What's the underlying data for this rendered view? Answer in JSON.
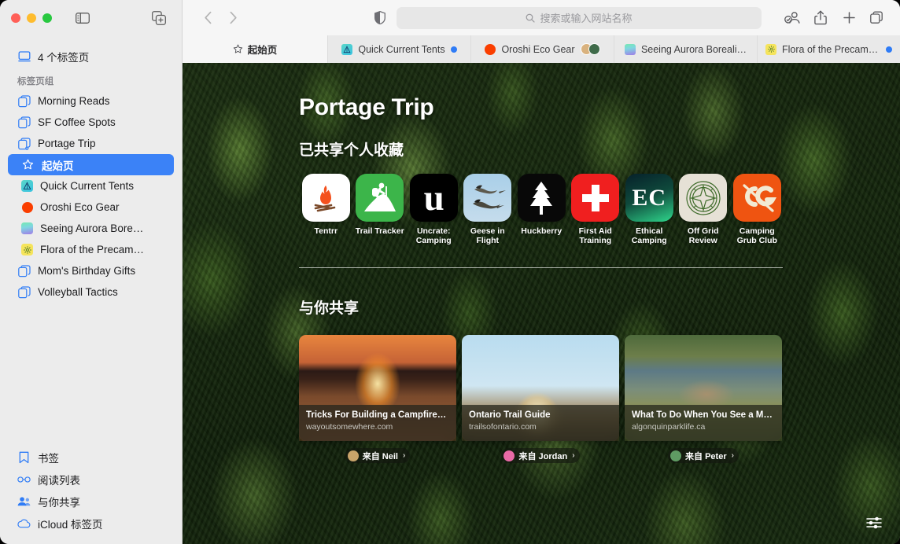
{
  "window": {
    "traffic_lights": [
      "close",
      "minimize",
      "zoom"
    ],
    "sidebar_toggle_icon": "sidebar-toggle-icon",
    "new_tab_group_icon": "new-tab-group-icon"
  },
  "sidebar": {
    "tab_count_label": "4 个标签页",
    "tab_count_icon": "window-icon",
    "group_header": "标签页组",
    "groups": [
      {
        "label": "Morning Reads",
        "icon": "tab-group-icon"
      },
      {
        "label": "SF Coffee Spots",
        "icon": "tab-group-icon"
      },
      {
        "label": "Portage Trip",
        "icon": "shared-tab-group-icon"
      }
    ],
    "tabs": [
      {
        "label": "起始页",
        "icon": "star-icon",
        "selected": true
      },
      {
        "label": "Quick Current Tents",
        "favicon": "tent-favicon",
        "selected": false
      },
      {
        "label": "Oroshi Eco Gear",
        "favicon": "orange-circle-favicon",
        "selected": false
      },
      {
        "label": "Seeing Aurora Bore…",
        "favicon": "aurora-gradient-favicon",
        "selected": false
      },
      {
        "label": "Flora of the Precam…",
        "favicon": "yellow-flora-favicon",
        "selected": false
      }
    ],
    "groups_after": [
      {
        "label": "Mom's Birthday Gifts",
        "icon": "tab-group-icon"
      },
      {
        "label": "Volleyball Tactics",
        "icon": "tab-group-icon"
      }
    ],
    "footer": [
      {
        "label": "书签",
        "icon": "bookmark-icon"
      },
      {
        "label": "阅读列表",
        "icon": "reading-list-icon"
      },
      {
        "label": "与你共享",
        "icon": "shared-with-you-icon"
      },
      {
        "label": "iCloud 标签页",
        "icon": "icloud-icon"
      }
    ]
  },
  "toolbar": {
    "back_icon": "chevron-left-icon",
    "forward_icon": "chevron-right-icon",
    "shield_icon": "privacy-shield-icon",
    "address_placeholder": "搜索或输入网站名称",
    "search_icon": "search-icon",
    "share_participants_icon": "shared-participants-icon",
    "share_icon": "share-icon",
    "new_tab_icon": "plus-icon",
    "tab_overview_icon": "tab-overview-icon"
  },
  "tabbar": {
    "tabs": [
      {
        "label": "起始页",
        "icon": "star-icon",
        "active": true,
        "dot": false,
        "avatars": []
      },
      {
        "label": "Quick Current Tents",
        "favicon": "tent-favicon",
        "active": false,
        "dot": true,
        "avatars": []
      },
      {
        "label": "Oroshi Eco Gear",
        "favicon": "orange-circle-favicon",
        "active": false,
        "dot": false,
        "avatars": [
          "avatar-a",
          "avatar-b"
        ]
      },
      {
        "label": "Seeing Aurora Boreali…",
        "favicon": "aurora-gradient-favicon",
        "active": false,
        "dot": false,
        "avatars": []
      },
      {
        "label": "Flora of the Precambi…",
        "favicon": "yellow-flora-favicon",
        "active": false,
        "dot": true,
        "avatars": []
      }
    ]
  },
  "start_page": {
    "title": "Portage Trip",
    "favorites_heading": "已共享个人收藏",
    "favorites": [
      {
        "name": "Tentrr",
        "icon": "campfire-favicon",
        "bg": "#ffffff"
      },
      {
        "name": "Trail Tracker",
        "icon": "hiker-favicon",
        "bg": "#3cb54a"
      },
      {
        "name": "Uncrate: Camping",
        "icon": "uncrate-u-favicon",
        "bg": "#000000"
      },
      {
        "name": "Geese in Flight",
        "icon": "geese-favicon",
        "bg": "#a8cce4"
      },
      {
        "name": "Huckberry",
        "icon": "pine-tree-favicon",
        "bg": "#0a0a0a"
      },
      {
        "name": "First Aid Training",
        "icon": "red-cross-favicon",
        "bg": "#f01f1f"
      },
      {
        "name": "Ethical Camping",
        "icon": "ec-monogram-favicon",
        "bg": "#0f3b32"
      },
      {
        "name": "Off Grid Review",
        "icon": "compass-favicon",
        "bg": "#e6e1d6"
      },
      {
        "name": "Camping Grub Club",
        "icon": "cg-skewer-favicon",
        "bg": "#ef5411"
      }
    ],
    "shared_heading": "与你共享",
    "shared_cards": [
      {
        "title": "Tricks For Building a Campfire—F…",
        "url": "wayoutsomewhere.com",
        "image": "campfire-at-sunset-photo",
        "from_label": "来自 Neil",
        "avatar": "avatar-neil",
        "avatar_color": "#c9a46a",
        "chevron": "chevron-right-icon"
      },
      {
        "title": "Ontario Trail Guide",
        "url": "trailsofontario.com",
        "image": "hiker-legs-sunset-photo",
        "from_label": "来自 Jordan",
        "avatar": "avatar-jordan",
        "avatar_color": "#e96aa6",
        "chevron": "chevron-right-icon"
      },
      {
        "title": "What To Do When You See a Moo…",
        "url": "algonquinparklife.ca",
        "image": "elk-by-lake-photo",
        "from_label": "来自 Peter",
        "avatar": "avatar-peter",
        "avatar_color": "#5f9b63",
        "chevron": "chevron-right-icon"
      }
    ],
    "preferences_icon": "sliders-icon",
    "background": "aerial-forest-photo"
  },
  "colors": {
    "accent": "#3b82f7",
    "sidebar_bg": "#ececec",
    "toolbar_bg": "#f6f6f6",
    "tab_inactive_bg": "#e9e9e9"
  }
}
